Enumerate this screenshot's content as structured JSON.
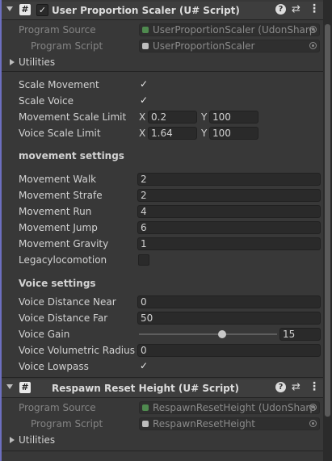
{
  "components": [
    {
      "title": "User Proportion Scaler (U# Script)",
      "enabled": true,
      "program_source_label": "Program Source",
      "program_source_value": "UserProportionScaler (UdonSharp",
      "program_script_label": "Program Script",
      "program_script_value": "UserProportionScaler",
      "utilities_label": "Utilities"
    },
    {
      "title": "Respawn Reset Height (U# Script)",
      "program_source_label": "Program Source",
      "program_source_value": "RespawnResetHeight (UdonSharp",
      "program_script_label": "Program Script",
      "program_script_value": "RespawnResetHeight",
      "utilities_label": "Utilities"
    }
  ],
  "icons": {
    "script": "#",
    "check": "✓",
    "help": "?",
    "preset": "⇄",
    "menu": "⋮"
  },
  "fields": {
    "scale_movement": {
      "label": "Scale Movement",
      "checked": true
    },
    "scale_voice": {
      "label": "Scale Voice",
      "checked": true
    },
    "movement_scale_limit": {
      "label": "Movement Scale Limit",
      "x_label": "X",
      "x": "0.2",
      "y_label": "Y",
      "y": "100"
    },
    "voice_scale_limit": {
      "label": "Voice Scale Limit",
      "x_label": "X",
      "x": "1.64",
      "y_label": "Y",
      "y": "100"
    }
  },
  "movement_settings": {
    "header": "movement settings",
    "walk": {
      "label": "Movement Walk",
      "value": "2"
    },
    "strafe": {
      "label": "Movement Strafe",
      "value": "2"
    },
    "run": {
      "label": "Movement Run",
      "value": "4"
    },
    "jump": {
      "label": "Movement Jump",
      "value": "6"
    },
    "gravity": {
      "label": "Movement Gravity",
      "value": "1"
    },
    "legacy": {
      "label": "Legacylocomotion",
      "checked": false
    }
  },
  "voice_settings": {
    "header": "Voice settings",
    "near": {
      "label": "Voice Distance Near",
      "value": "0"
    },
    "far": {
      "label": "Voice Distance Far",
      "value": "50"
    },
    "gain": {
      "label": "Voice Gain",
      "value": "15",
      "slider_fraction": 0.6
    },
    "radius": {
      "label": "Voice Volumetric Radius",
      "value": "0"
    },
    "lowpass": {
      "label": "Voice Lowpass",
      "checked": true
    }
  },
  "colors": {
    "panel_bg": "#383838",
    "header_bg": "#3e3e3e",
    "field_bg": "#2a2a2a",
    "accent_bar": "#6d6fbf",
    "source_icon": "#4f8a4f",
    "script_icon": "#bdbdbd"
  }
}
